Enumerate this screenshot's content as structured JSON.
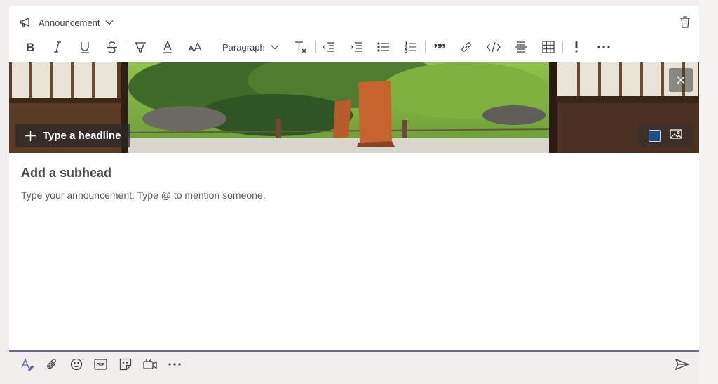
{
  "composer": {
    "post_type_label": "Announcement",
    "toolbar": {
      "paragraph_label": "Paragraph",
      "quote_label": "””"
    },
    "banner": {
      "headline_placeholder": "Type a headline",
      "color": "#1d4e89"
    },
    "subhead_placeholder": "Add a subhead",
    "body_placeholder": "Type your announcement. Type @ to mention someone."
  },
  "colors": {
    "accent": "#6264a7",
    "icon": "#424242"
  }
}
